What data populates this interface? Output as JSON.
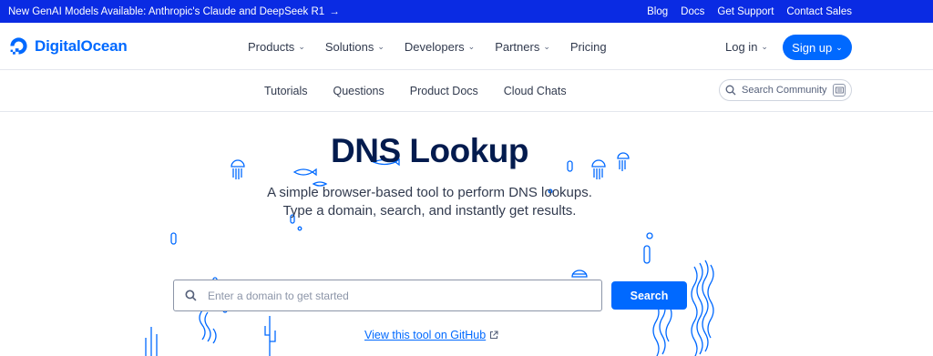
{
  "announcement": {
    "text": "New GenAI Models Available: Anthropic's Claude and DeepSeek R1",
    "arrow": "→",
    "links": [
      "Blog",
      "Docs",
      "Get Support",
      "Contact Sales"
    ]
  },
  "header": {
    "logo_text": "DigitalOcean",
    "nav": [
      {
        "label": "Products",
        "has_menu": true
      },
      {
        "label": "Solutions",
        "has_menu": true
      },
      {
        "label": "Developers",
        "has_menu": true
      },
      {
        "label": "Partners",
        "has_menu": true
      },
      {
        "label": "Pricing",
        "has_menu": false
      }
    ],
    "login_label": "Log in",
    "signup_label": "Sign up",
    "chevron": "⌄"
  },
  "subnav": {
    "links": [
      "Tutorials",
      "Questions",
      "Product Docs",
      "Cloud Chats"
    ],
    "search_label": "Search Community",
    "kbd_icon": "keyboard-icon"
  },
  "hero": {
    "title": "DNS Lookup",
    "description_line1": "A simple browser-based tool to perform DNS lookups.",
    "description_line2": "Type a domain, search, and instantly get results.",
    "search_placeholder": "Enter a domain to get started",
    "search_button": "Search",
    "github_link": "View this tool on GitHub"
  },
  "colors": {
    "brand_blue": "#0069ff",
    "banner_blue": "#0a2be3",
    "navy": "#031b4e",
    "illustration": "#0069ff"
  }
}
